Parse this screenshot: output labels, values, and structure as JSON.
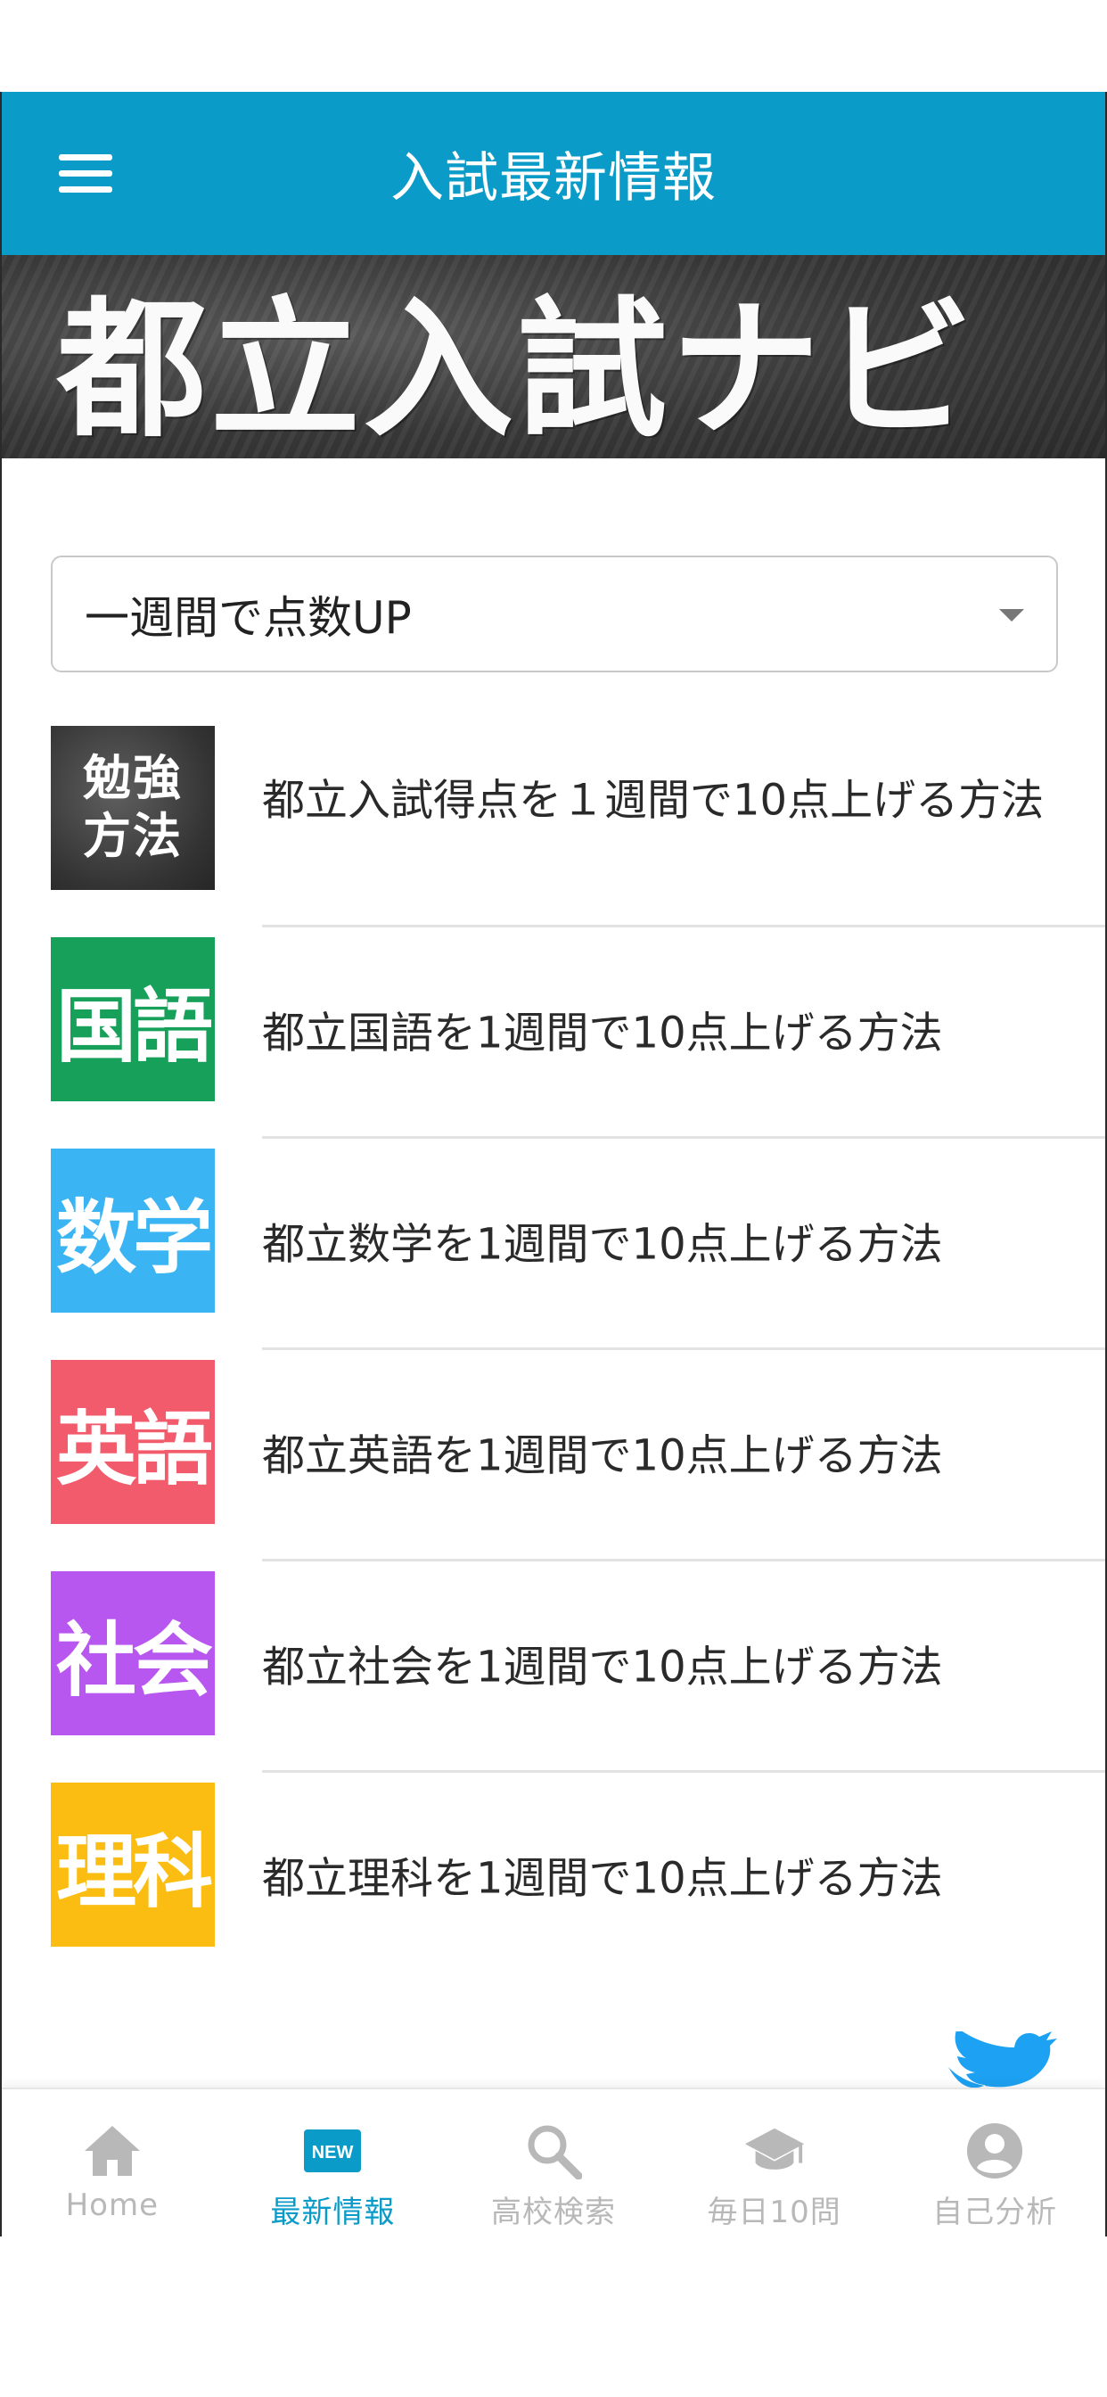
{
  "app_bar": {
    "title": "入試最新情報"
  },
  "banner": {
    "text": "都立入試ナビ"
  },
  "dropdown": {
    "selected": "一週間で点数UP"
  },
  "articles": [
    {
      "thumb_line1": "勉強",
      "thumb_line2": "方法",
      "title": "都立入試得点を１週間で10点上げる方法",
      "thumb_color": "#3a3a3a"
    },
    {
      "thumb": "国語",
      "title": "都立国語を1週間で10点上げる方法",
      "thumb_color": "#16a05a"
    },
    {
      "thumb": "数学",
      "title": "都立数学を1週間で10点上げる方法",
      "thumb_color": "#3ab4f2"
    },
    {
      "thumb": "英語",
      "title": "都立英語を1週間で10点上げる方法",
      "thumb_color": "#f25b6b"
    },
    {
      "thumb": "社会",
      "title": "都立社会を1週間で10点上げる方法",
      "thumb_color": "#b857f0"
    },
    {
      "thumb": "理科",
      "title": "都立理科を1週間で10点上げる方法",
      "thumb_color": "#fbbd12"
    }
  ],
  "bottom_nav": [
    {
      "label": "Home",
      "icon": "home-icon",
      "active": false
    },
    {
      "label": "最新情報",
      "icon": "new-badge-icon",
      "badge": "NEW",
      "active": true
    },
    {
      "label": "高校検索",
      "icon": "search-icon",
      "active": false
    },
    {
      "label": "毎日10問",
      "icon": "graduation-cap-icon",
      "active": false
    },
    {
      "label": "自己分析",
      "icon": "account-circle-icon",
      "active": false
    }
  ],
  "colors": {
    "primary": "#0a9bc8",
    "inactive": "#b8b8b8",
    "twitter": "#1da1f2"
  }
}
